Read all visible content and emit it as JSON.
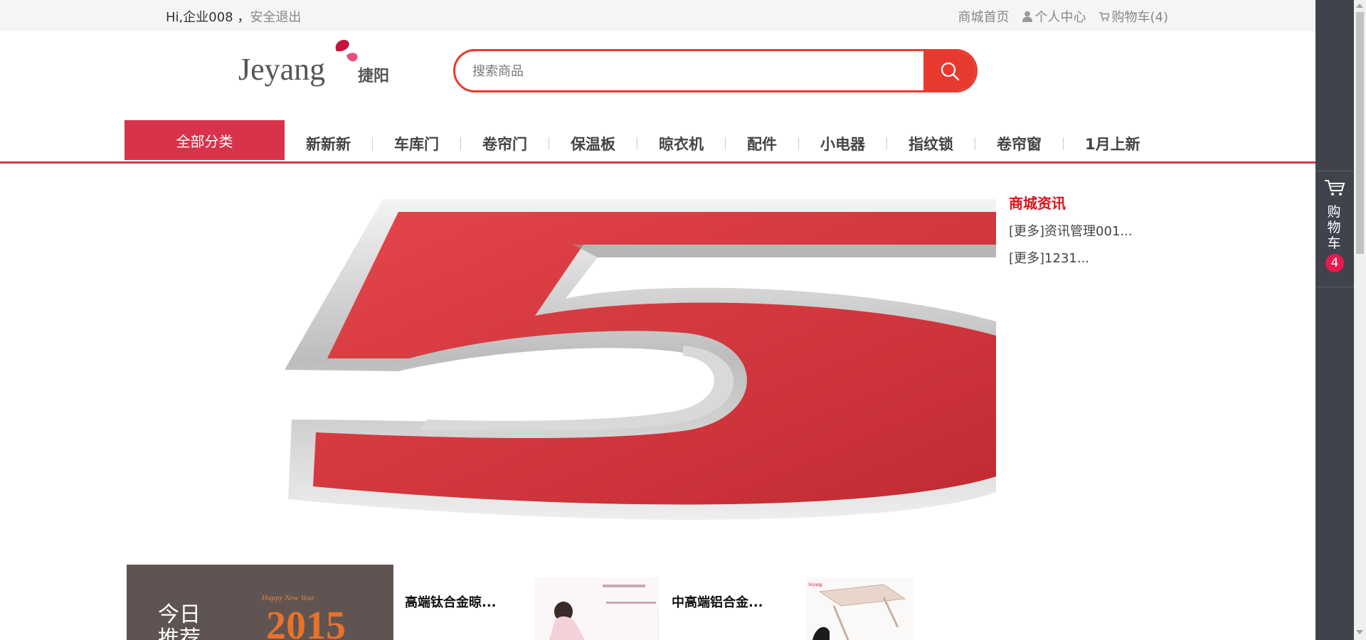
{
  "topbar": {
    "greeting": "Hi,企业008 ，",
    "logout": "安全退出",
    "home": "商城首页",
    "profile": "个人中心",
    "cart": "购物车(4)"
  },
  "logo": {
    "en": "Jeyang",
    "cn": "捷阳"
  },
  "search": {
    "placeholder": "搜索商品"
  },
  "nav": {
    "all_categories": "全部分类",
    "items": [
      "新新新",
      "车库门",
      "卷帘门",
      "保温板",
      "晾衣机",
      "配件",
      "小电器",
      "指纹锁",
      "卷帘窗",
      "1月上新"
    ]
  },
  "banner": {
    "numeral": "5"
  },
  "news": {
    "title": "商城资讯",
    "items": [
      "[更多]资讯管理001...",
      "[更多]1231..."
    ]
  },
  "today": {
    "label": "今日推荐"
  },
  "products": [
    {
      "name": "高端钛合金晾..."
    },
    {
      "name": "中高端铝合金..."
    }
  ],
  "sidebar": {
    "cart_label": "购物车",
    "cart_count": "4"
  },
  "colors": {
    "accent": "#e8392e",
    "nav_red": "#d8334a",
    "news_red": "#e0101a",
    "sidebar": "#40434b"
  }
}
